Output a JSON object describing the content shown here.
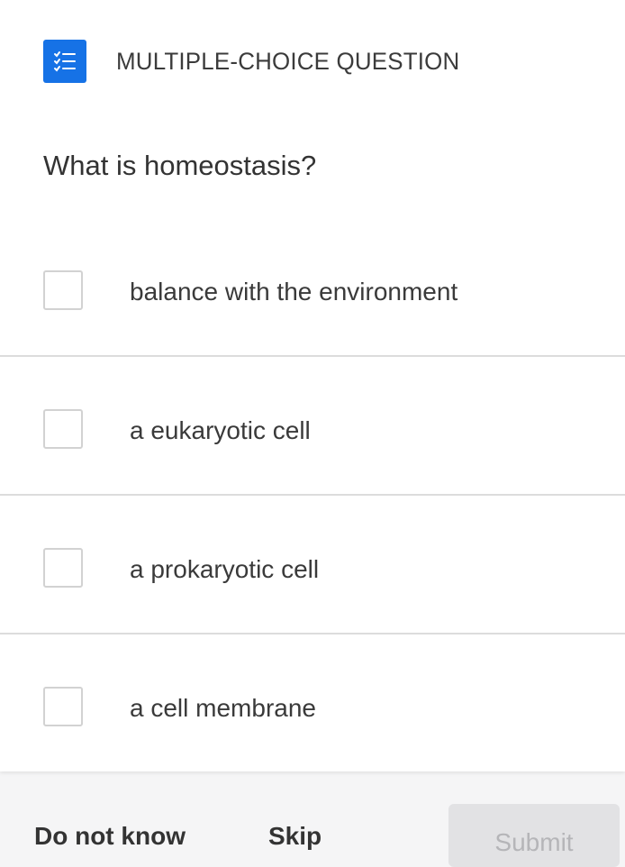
{
  "header": {
    "icon": "checklist-icon",
    "label": "MULTIPLE-CHOICE QUESTION",
    "accent_color": "#1672e6"
  },
  "question": {
    "text": "What is homeostasis?"
  },
  "options": [
    {
      "label": "balance with the environment",
      "checked": false
    },
    {
      "label": "a eukaryotic cell",
      "checked": false
    },
    {
      "label": "a prokaryotic cell",
      "checked": false
    },
    {
      "label": "a cell membrane",
      "checked": false
    }
  ],
  "footer": {
    "left_link": "Do not know",
    "middle_link": "Skip",
    "submit_label": "Submit",
    "submit_disabled": true
  }
}
